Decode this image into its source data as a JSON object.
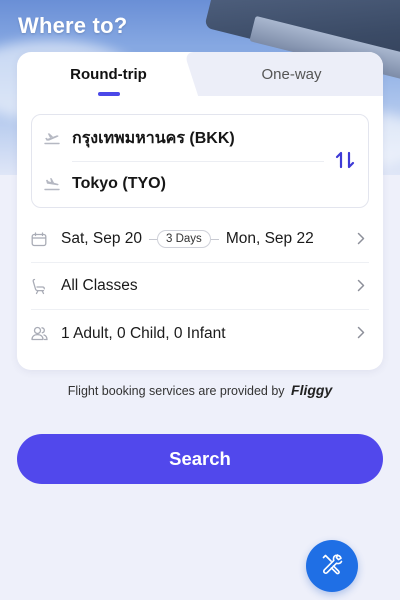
{
  "header": {
    "title": "Where to?"
  },
  "tabs": [
    {
      "label": "Round-trip",
      "active": true
    },
    {
      "label": "One-way",
      "active": false
    }
  ],
  "route": {
    "from": "กรุงเทพมหานคร (BKK)",
    "to": "Tokyo (TYO)",
    "from_icon": "takeoff-icon",
    "to_icon": "landing-icon",
    "swap_icon": "swap-icon"
  },
  "dates": {
    "depart": "Sat, Sep 20",
    "duration": "3 Days",
    "return": "Mon, Sep 22",
    "icon": "calendar-icon"
  },
  "cabin": {
    "label": "All Classes",
    "icon": "seat-icon"
  },
  "passengers": {
    "label": "1 Adult, 0 Child, 0 Infant",
    "icon": "users-icon"
  },
  "provider": {
    "text": "Flight booking services are provided by",
    "brand": "Fliggy"
  },
  "search": {
    "label": "Search"
  },
  "fab": {
    "icon": "tools-icon"
  },
  "colors": {
    "accent": "#5148ec",
    "fab": "#1f6fe5",
    "tab_indicator": "#4b48e8"
  }
}
